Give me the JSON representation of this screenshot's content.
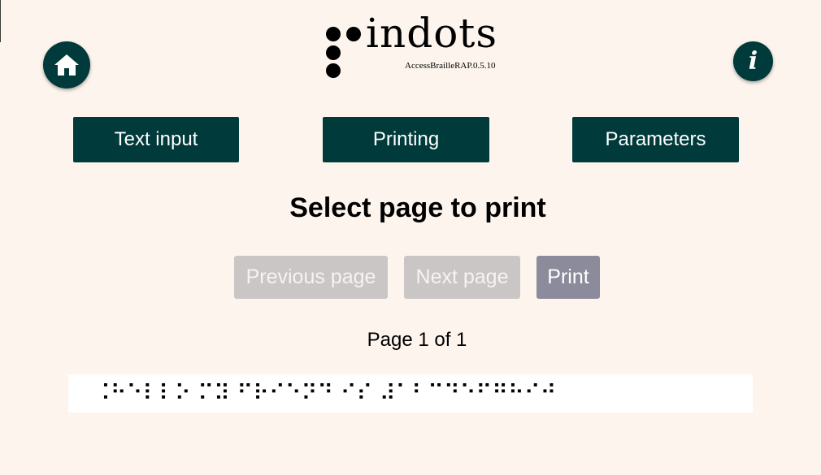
{
  "header": {
    "logo_word": "indots",
    "version": "AccessBrailleRAP.0.5.10",
    "info_label": "i"
  },
  "icons": {
    "home": "home-icon",
    "info": "info-icon",
    "logo_dots": "braille-dots-logo-icon"
  },
  "nav": {
    "text_input": "Text input",
    "printing": "Printing",
    "parameters": "Parameters"
  },
  "main": {
    "title": "Select page to print",
    "previous_label": "Previous page",
    "next_label": "Next page",
    "print_label": "Print",
    "page_info": "Page 1 of 1",
    "braille_preview": "⠨⠓⠑⠇⠇⠕ ⠍⠽ ⠋⠗⠊⠑⠝⠙ ⠊⠎ ⠼⠁⠃⠉⠙⠑⠋⠛⠓⠊⠚"
  },
  "colors": {
    "background": "#fdf5ed",
    "primary": "#003a3a",
    "disabled": "#cac6c6",
    "print_button": "#8b8b9b"
  }
}
